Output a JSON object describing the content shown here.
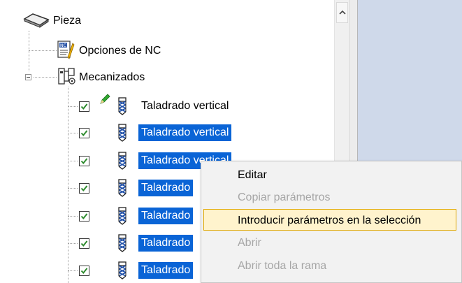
{
  "tree": {
    "root": {
      "label": "Pieza",
      "icon": "part-icon"
    },
    "nc_options": {
      "label": "Opciones de NC",
      "icon": "nc-options-icon"
    },
    "machinings": {
      "label": "Mecanizados",
      "icon": "machining-icon",
      "expanded": true
    },
    "operations": [
      {
        "label": "Taladrado vertical",
        "checked": true,
        "selected": false,
        "edit_icon": true
      },
      {
        "label": "Taladrado vertical",
        "checked": true,
        "selected": true
      },
      {
        "label": "Taladrado vertical",
        "checked": true,
        "selected": true
      },
      {
        "label": "Taladrado",
        "checked": true,
        "selected": true
      },
      {
        "label": "Taladrado",
        "checked": true,
        "selected": true
      },
      {
        "label": "Taladrado",
        "checked": true,
        "selected": true
      },
      {
        "label": "Taladrado",
        "checked": true,
        "selected": true
      }
    ]
  },
  "context_menu": {
    "items": [
      {
        "label": "Editar",
        "enabled": true,
        "highlighted": false
      },
      {
        "label": "Copiar parámetros",
        "enabled": false,
        "highlighted": false
      },
      {
        "label": "Introducir parámetros en la selección",
        "enabled": true,
        "highlighted": true
      },
      {
        "label": "Abrir",
        "enabled": false,
        "highlighted": false
      },
      {
        "label": "Abrir toda la rama",
        "enabled": false,
        "highlighted": false
      }
    ]
  },
  "colors": {
    "selection": "#0a64d6",
    "highlight_bg": "#fff3cd",
    "highlight_border": "#e0a800",
    "right_pane": "#cfd9ea",
    "disabled_text": "#a6a6a6"
  }
}
